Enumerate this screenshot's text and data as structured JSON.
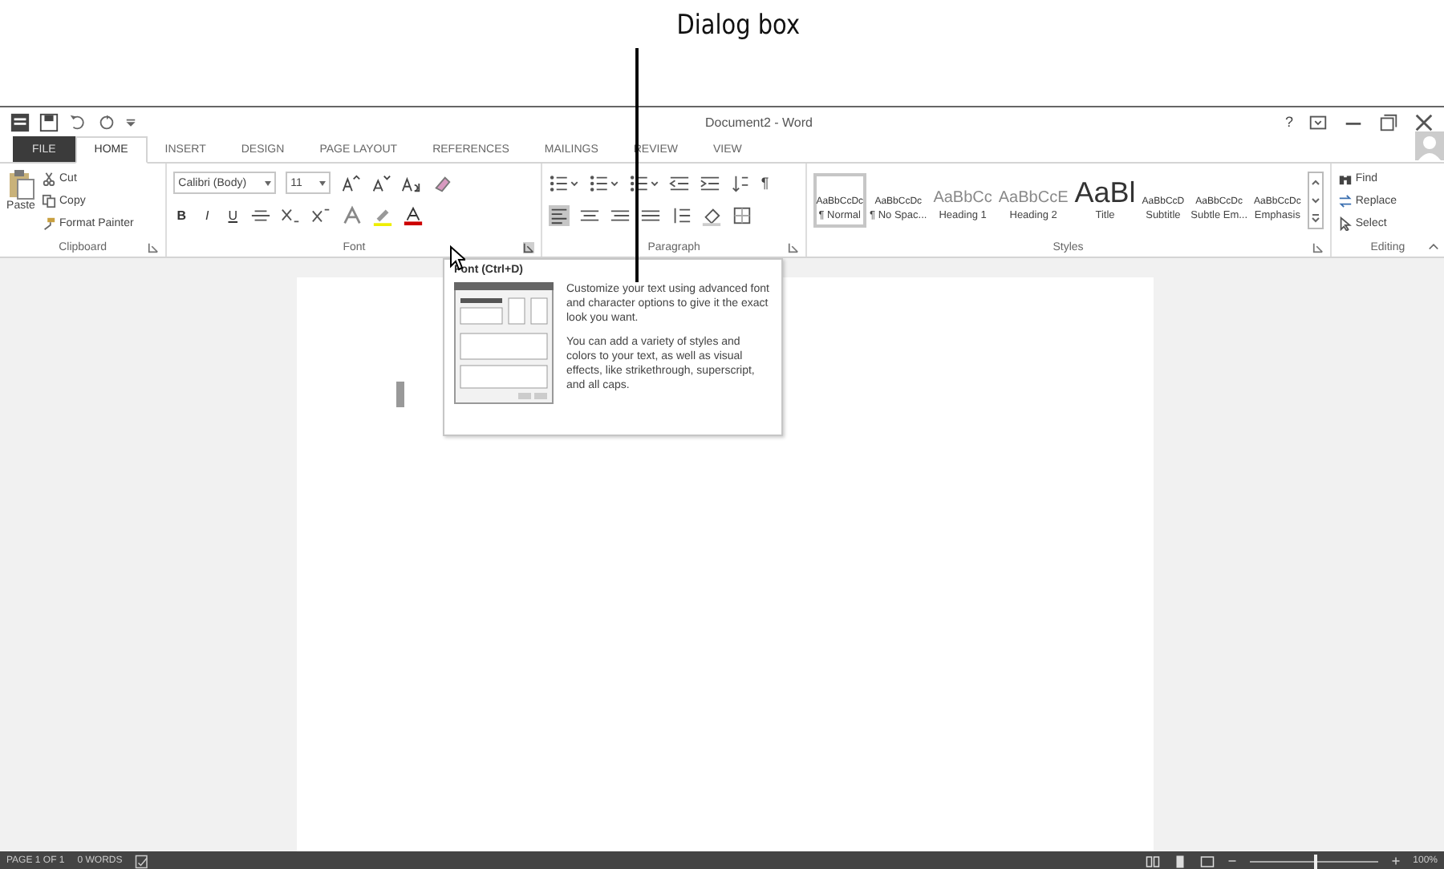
{
  "callout": {
    "label": "Dialog box"
  },
  "window": {
    "title": "Document2 - Word",
    "help": "?"
  },
  "tabs": [
    {
      "label": "FILE",
      "selected": false,
      "kind": "file"
    },
    {
      "label": "HOME",
      "selected": true,
      "kind": "tab"
    },
    {
      "label": "INSERT",
      "selected": false,
      "kind": "tab"
    },
    {
      "label": "DESIGN",
      "selected": false,
      "kind": "tab"
    },
    {
      "label": "PAGE LAYOUT",
      "selected": false,
      "kind": "tab"
    },
    {
      "label": "REFERENCES",
      "selected": false,
      "kind": "tab"
    },
    {
      "label": "MAILINGS",
      "selected": false,
      "kind": "tab"
    },
    {
      "label": "REVIEW",
      "selected": false,
      "kind": "tab"
    },
    {
      "label": "VIEW",
      "selected": false,
      "kind": "tab"
    }
  ],
  "clipboard": {
    "paste": "Paste",
    "cut": "Cut",
    "copy": "Copy",
    "format_painter": "Format Painter",
    "group": "Clipboard"
  },
  "font": {
    "name": "Calibri (Body)",
    "size": "11",
    "bold": "B",
    "italic": "I",
    "underline": "U",
    "group": "Font"
  },
  "paragraph": {
    "group": "Paragraph",
    "pilcrow": "¶"
  },
  "styles": {
    "group": "Styles",
    "items": [
      {
        "preview": "AaBbCcDc",
        "name": "¶ Normal",
        "selected": true,
        "kind": "small"
      },
      {
        "preview": "AaBbCcDc",
        "name": "¶ No Spac...",
        "selected": false,
        "kind": "small"
      },
      {
        "preview": "AaBbCc",
        "name": "Heading 1",
        "selected": false,
        "kind": "heading"
      },
      {
        "preview": "AaBbCcE",
        "name": "Heading 2",
        "selected": false,
        "kind": "heading"
      },
      {
        "preview": "AaBl",
        "name": "Title",
        "selected": false,
        "kind": "title"
      },
      {
        "preview": "AaBbCcD",
        "name": "Subtitle",
        "selected": false,
        "kind": "small"
      },
      {
        "preview": "AaBbCcDc",
        "name": "Subtle Em...",
        "selected": false,
        "kind": "small"
      },
      {
        "preview": "AaBbCcDc",
        "name": "Emphasis",
        "selected": false,
        "kind": "small"
      }
    ]
  },
  "editing": {
    "group": "Editing",
    "find": "Find",
    "replace": "Replace",
    "select": "Select"
  },
  "tooltip": {
    "title": "Font (Ctrl+D)",
    "paragraphs": [
      "Customize your text using advanced font and character options to give it the exact look you want.",
      "You can add a variety of styles and colors to your text, as well as visual effects, like strikethrough, superscript, and all caps."
    ]
  },
  "status_bar": {
    "page": "PAGE 1 OF 1",
    "words": "0 WORDS",
    "zoom": {
      "level": 0.5,
      "reading": "100%"
    }
  }
}
